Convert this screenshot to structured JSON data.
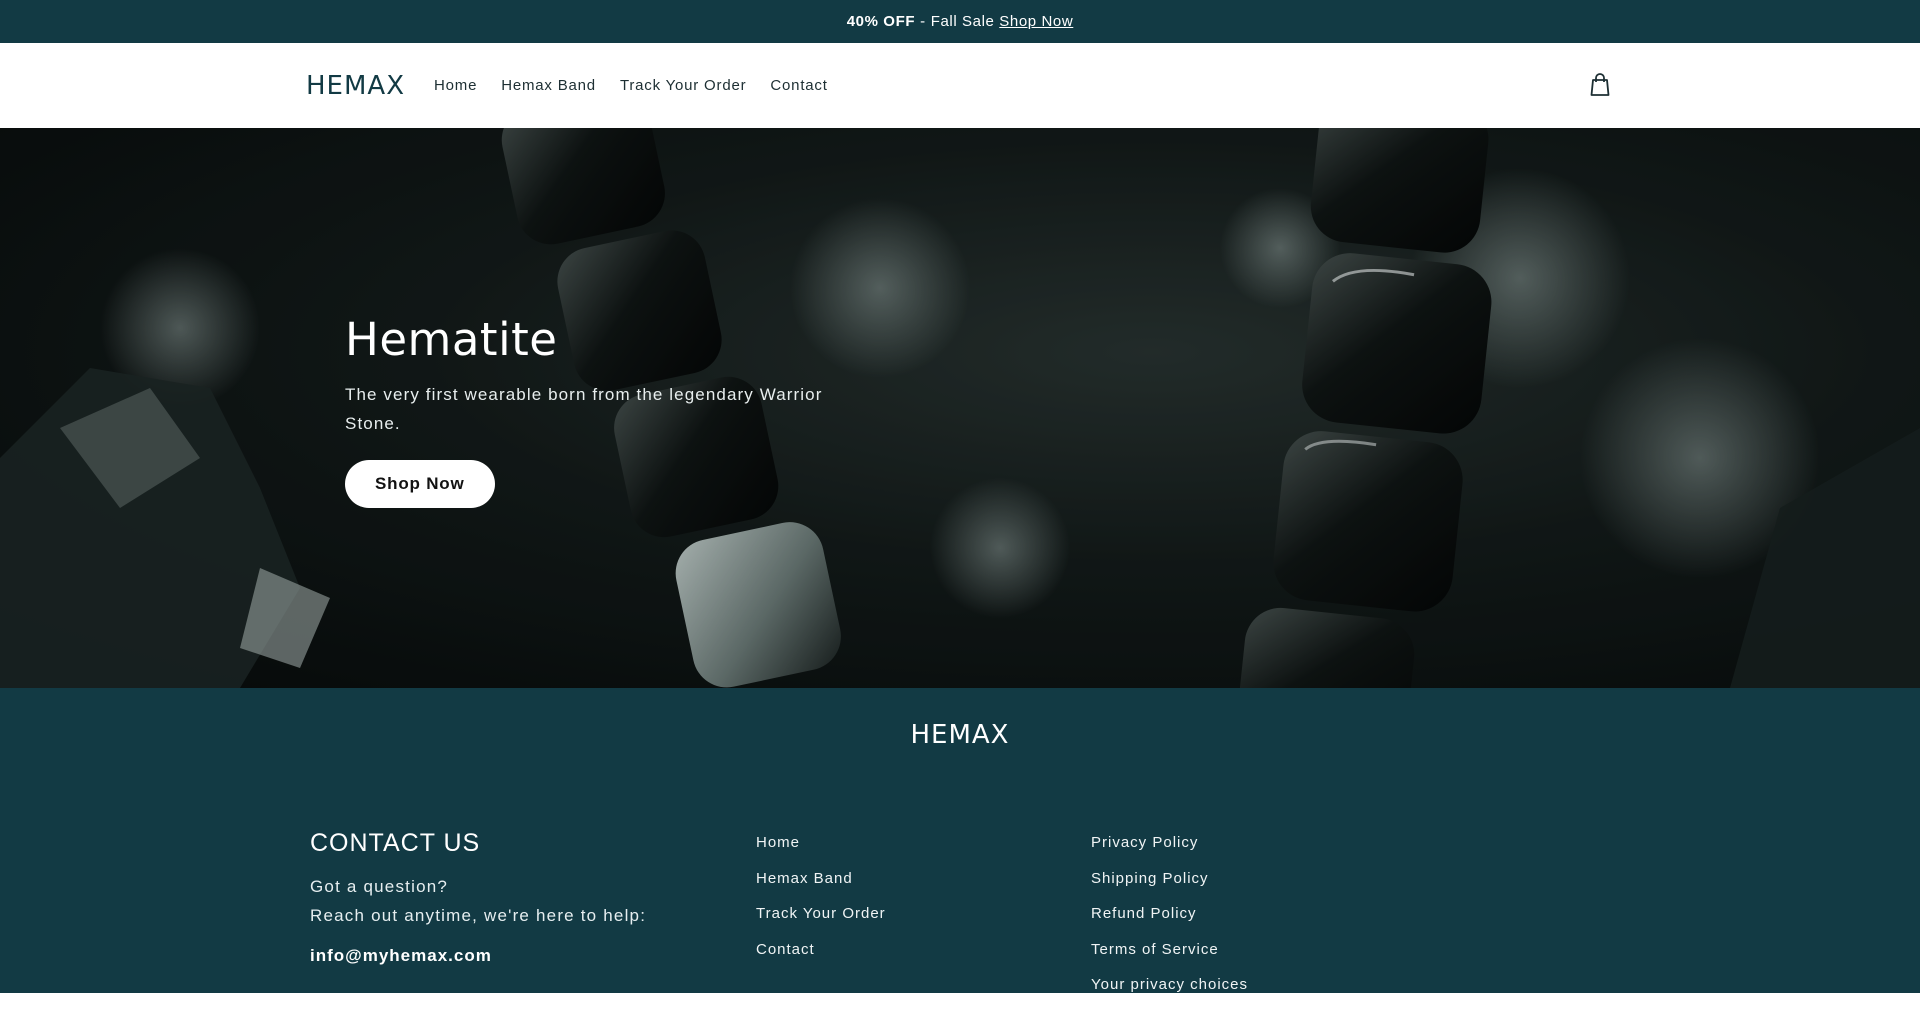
{
  "announcement": {
    "highlight": "40% OFF",
    "separator": "-",
    "text": "Fall Sale",
    "link": "Shop Now"
  },
  "header": {
    "logo": "HEMAX",
    "nav": [
      "Home",
      "Hemax Band",
      "Track Your Order",
      "Contact"
    ],
    "cart_icon": "shopping-bag-icon"
  },
  "hero": {
    "title": "Hematite",
    "subtitle": "The very first wearable born from the legendary Warrior Stone.",
    "button": "Shop Now"
  },
  "footer": {
    "logo": "HEMAX",
    "contact": {
      "heading": "CONTACT US",
      "line1": "Got a question?",
      "line2": "Reach out anytime, we're here to help:",
      "email": "info@myhemax.com"
    },
    "menu_links": [
      "Home",
      "Hemax Band",
      "Track Your Order",
      "Contact"
    ],
    "policy_links": [
      "Privacy Policy",
      "Shipping Policy",
      "Refund Policy",
      "Terms of Service",
      "Your privacy choices"
    ]
  },
  "colors": {
    "brand_dark_teal": "#123a44",
    "white": "#ffffff"
  }
}
